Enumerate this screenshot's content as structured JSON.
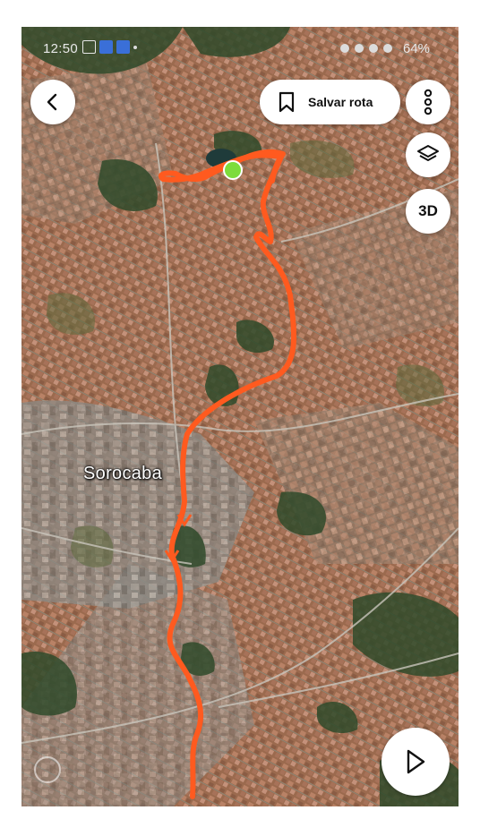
{
  "status_bar": {
    "time": "12:50",
    "battery": "64%"
  },
  "map": {
    "city_label": "Sorocaba",
    "route_color": "#ff5a1f",
    "start_marker_color": "#7ddc3c"
  },
  "toolbar": {
    "save_route_label": "Salvar rota",
    "threed_label": "3D"
  },
  "icons": {
    "back": "chevron-left-icon",
    "bookmark": "bookmark-icon",
    "more": "more-vertical-icon",
    "layers": "layers-icon",
    "play": "play-icon",
    "compass": "compass-icon"
  }
}
